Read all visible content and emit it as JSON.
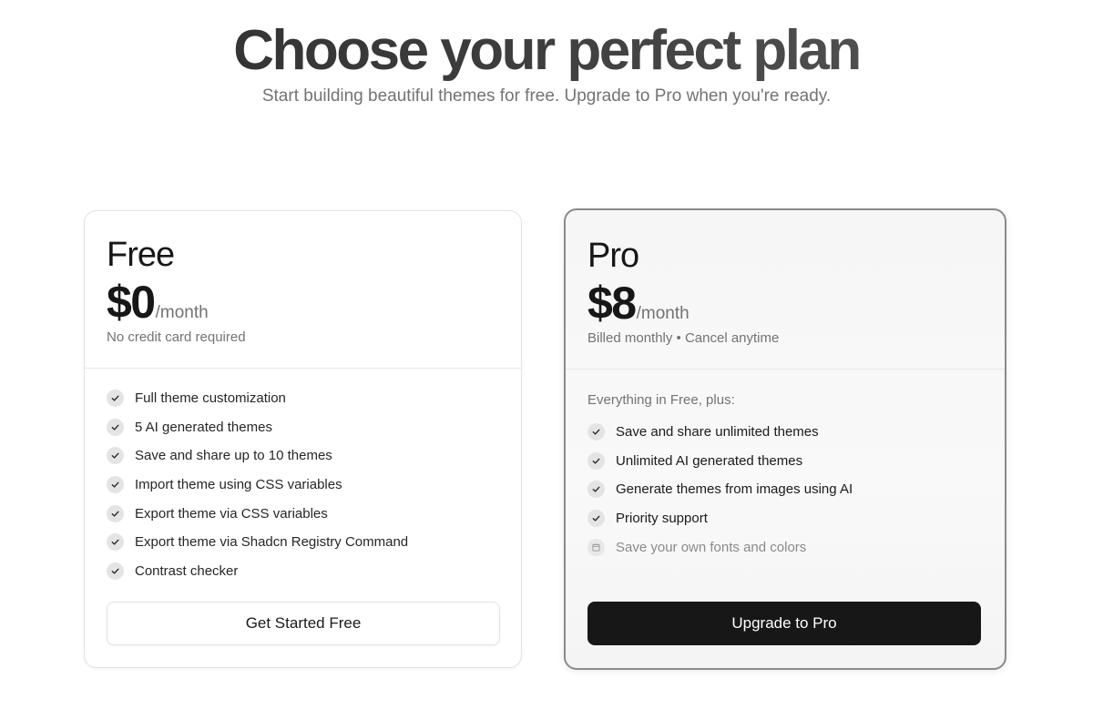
{
  "hero": {
    "title": "Choose your perfect plan",
    "subtitle": "Start building beautiful themes for free. Upgrade to Pro when you're ready."
  },
  "plans": [
    {
      "name": "Free",
      "price": "$0",
      "period": "/month",
      "note": "No credit card required",
      "features_intro": "",
      "features": [
        {
          "label": "Full theme customization",
          "icon": "check-icon"
        },
        {
          "label": "5 AI generated themes",
          "icon": "check-icon"
        },
        {
          "label": "Save and share up to 10 themes",
          "icon": "check-icon"
        },
        {
          "label": "Import theme using CSS variables",
          "icon": "check-icon"
        },
        {
          "label": "Export theme via CSS variables",
          "icon": "check-icon"
        },
        {
          "label": "Export theme via Shadcn Registry Command",
          "icon": "check-icon"
        },
        {
          "label": "Contrast checker",
          "icon": "check-icon"
        }
      ],
      "cta": "Get Started Free"
    },
    {
      "name": "Pro",
      "price": "$8",
      "period": "/month",
      "note": "Billed monthly • Cancel anytime",
      "features_intro": "Everything in Free, plus:",
      "features": [
        {
          "label": "Save and share unlimited themes",
          "icon": "check-icon"
        },
        {
          "label": "Unlimited AI generated themes",
          "icon": "check-icon"
        },
        {
          "label": "Generate themes from images using AI",
          "icon": "check-icon"
        },
        {
          "label": "Priority support",
          "icon": "check-icon"
        },
        {
          "label": "Save your own fonts and colors",
          "icon": "calendar-icon"
        }
      ],
      "cta": "Upgrade to Pro"
    }
  ],
  "colors": {
    "primary_button": "#171717",
    "muted_text": "#737373",
    "check_badge": "#e4e4e4"
  }
}
